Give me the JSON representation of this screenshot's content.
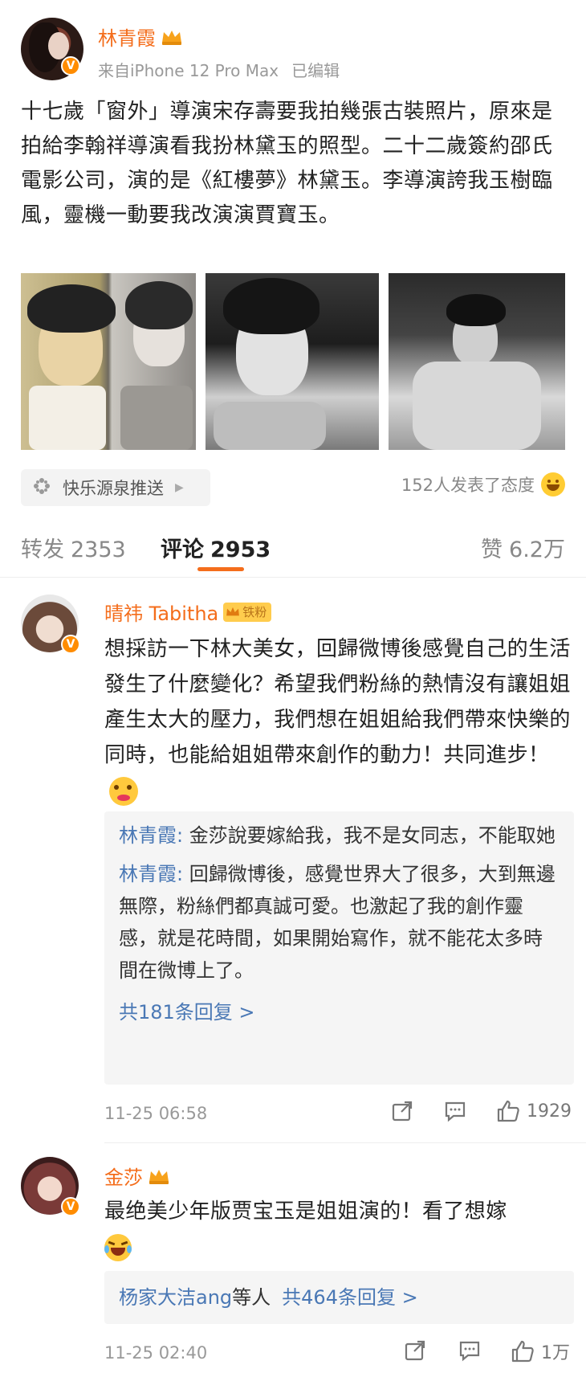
{
  "post": {
    "author": "林青霞",
    "source": "来自iPhone 12 Pro Max",
    "edited": "已编辑",
    "text": "十七歲「窗外」導演宋存壽要我拍幾張古裝照片，原來是拍給李翰祥導演看我扮林黛玉的照型。二十二歲簽約邵氏電影公司，演的是《紅樓夢》林黛玉。李導演誇我玉樹臨風，靈機一動要我改演演賈寶玉。",
    "source_tag": "快乐源泉推送",
    "reactions": "152人发表了态度"
  },
  "tabs": {
    "repost_label": "转发",
    "repost_count": "2353",
    "comment_label": "评论",
    "comment_count": "2953",
    "like_label": "赞",
    "like_count": "6.2万"
  },
  "comments": [
    {
      "name": "晴祎 Tabitha",
      "badge": "铁粉",
      "text": "想採訪一下林大美女，回歸微博後感覺自己的生活發生了什麼變化？希望我們粉絲的熱情沒有讓姐姐產生太大的壓力，我們想在姐姐給我們帶來快樂的同時，也能給姐姐帶來創作的動力！共同進步！",
      "replies": [
        {
          "name": "林青霞:",
          "text": " 金莎說要嫁給我，我不是女同志，不能取她"
        },
        {
          "name": "林青霞:",
          "text": " 回歸微博後，感覺世界大了很多，大到無邊無際，粉絲們都真誠可愛。也激起了我的創作靈感，就是花時間，如果開始寫作，就不能花太多時間在微博上了。"
        }
      ],
      "more_replies": "共181条回复 >",
      "time": "11-25 06:58",
      "likes": "1929"
    },
    {
      "name": "金莎",
      "text": "最绝美少年版贾宝玉是姐姐演的！看了想嫁",
      "replies_prefix": "杨家大洁ang",
      "replies_mid": "等人",
      "more_replies": "共464条回复 >",
      "time": "11-25 02:40",
      "likes": "1万"
    }
  ],
  "colors": {
    "accent": "#f46d1b",
    "link": "#4a78b5",
    "muted": "#999999"
  }
}
